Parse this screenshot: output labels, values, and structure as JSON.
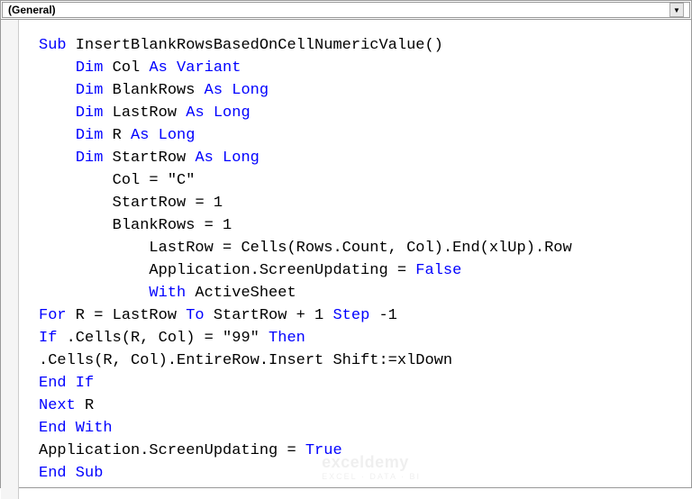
{
  "dropdown": {
    "scope_label": "(General)"
  },
  "code": {
    "lines": [
      {
        "indent": 0,
        "tokens": [
          {
            "t": "Sub",
            "c": "kw"
          },
          {
            "t": " InsertBlankRowsBasedOnCellNumericValue()",
            "c": "plain"
          }
        ]
      },
      {
        "indent": 1,
        "tokens": [
          {
            "t": "Dim",
            "c": "kw"
          },
          {
            "t": " Col ",
            "c": "plain"
          },
          {
            "t": "As Variant",
            "c": "kw"
          }
        ]
      },
      {
        "indent": 1,
        "tokens": [
          {
            "t": "Dim",
            "c": "kw"
          },
          {
            "t": " BlankRows ",
            "c": "plain"
          },
          {
            "t": "As Long",
            "c": "kw"
          }
        ]
      },
      {
        "indent": 1,
        "tokens": [
          {
            "t": "Dim",
            "c": "kw"
          },
          {
            "t": " LastRow ",
            "c": "plain"
          },
          {
            "t": "As Long",
            "c": "kw"
          }
        ]
      },
      {
        "indent": 1,
        "tokens": [
          {
            "t": "Dim",
            "c": "kw"
          },
          {
            "t": " R ",
            "c": "plain"
          },
          {
            "t": "As Long",
            "c": "kw"
          }
        ]
      },
      {
        "indent": 1,
        "tokens": [
          {
            "t": "Dim",
            "c": "kw"
          },
          {
            "t": " StartRow ",
            "c": "plain"
          },
          {
            "t": "As Long",
            "c": "kw"
          }
        ]
      },
      {
        "indent": 2,
        "tokens": [
          {
            "t": "Col = \"C\"",
            "c": "plain"
          }
        ]
      },
      {
        "indent": 2,
        "tokens": [
          {
            "t": "StartRow = 1",
            "c": "plain"
          }
        ]
      },
      {
        "indent": 2,
        "tokens": [
          {
            "t": "BlankRows = 1",
            "c": "plain"
          }
        ]
      },
      {
        "indent": 3,
        "tokens": [
          {
            "t": "LastRow = Cells(Rows.Count, Col).End(xlUp).Row",
            "c": "plain"
          }
        ]
      },
      {
        "indent": 3,
        "tokens": [
          {
            "t": "Application.ScreenUpdating = ",
            "c": "plain"
          },
          {
            "t": "False",
            "c": "kw"
          }
        ]
      },
      {
        "indent": 3,
        "tokens": [
          {
            "t": "With",
            "c": "kw"
          },
          {
            "t": " ActiveSheet",
            "c": "plain"
          }
        ]
      },
      {
        "indent": 0,
        "tokens": [
          {
            "t": "For",
            "c": "kw"
          },
          {
            "t": " R = LastRow ",
            "c": "plain"
          },
          {
            "t": "To",
            "c": "kw"
          },
          {
            "t": " StartRow + 1 ",
            "c": "plain"
          },
          {
            "t": "Step",
            "c": "kw"
          },
          {
            "t": " -1",
            "c": "plain"
          }
        ]
      },
      {
        "indent": 0,
        "tokens": [
          {
            "t": "If",
            "c": "kw"
          },
          {
            "t": " .Cells(R, Col) = \"99\" ",
            "c": "plain"
          },
          {
            "t": "Then",
            "c": "kw"
          }
        ]
      },
      {
        "indent": 0,
        "tokens": [
          {
            "t": ".Cells(R, Col).EntireRow.Insert Shift:=xlDown",
            "c": "plain"
          }
        ]
      },
      {
        "indent": 0,
        "tokens": [
          {
            "t": "End If",
            "c": "kw"
          }
        ]
      },
      {
        "indent": 0,
        "tokens": [
          {
            "t": "Next",
            "c": "kw"
          },
          {
            "t": " R",
            "c": "plain"
          }
        ]
      },
      {
        "indent": 0,
        "tokens": [
          {
            "t": "End With",
            "c": "kw"
          }
        ]
      },
      {
        "indent": 0,
        "tokens": [
          {
            "t": "Application.ScreenUpdating = ",
            "c": "plain"
          },
          {
            "t": "True",
            "c": "kw"
          }
        ]
      },
      {
        "indent": 0,
        "tokens": [
          {
            "t": "End Sub",
            "c": "kw"
          }
        ]
      }
    ],
    "indent_unit": "    "
  },
  "watermark": {
    "logo": "exceldemy",
    "tagline": "EXCEL · DATA · BI"
  }
}
